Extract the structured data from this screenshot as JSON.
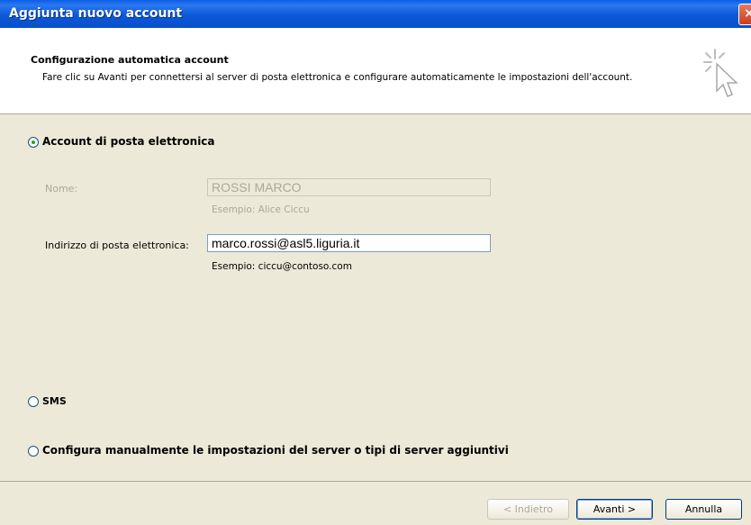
{
  "window": {
    "title": "Aggiunta nuovo account",
    "close_label": "×"
  },
  "header": {
    "title": "Configurazione automatica account",
    "description": "Fare clic su Avanti per connettersi al server di posta elettronica e configurare automaticamente le impostazioni dell'account."
  },
  "options": {
    "email_account": {
      "label": "Account di posta elettronica",
      "selected": true
    },
    "sms": {
      "label": "SMS",
      "selected": false
    },
    "manual": {
      "label": "Configura manualmente le impostazioni del server o tipi di server aggiuntivi",
      "selected": false
    }
  },
  "form": {
    "name": {
      "label": "Nome:",
      "value": "ROSSI MARCO",
      "example": "Esempio: Alice Ciccu"
    },
    "email": {
      "label": "Indirizzo di posta elettronica:",
      "value": "marco.rossi@asl5.liguria.it",
      "example": "Esempio: ciccu@contoso.com"
    }
  },
  "buttons": {
    "back": "< Indietro",
    "next": "Avanti >",
    "cancel": "Annulla"
  }
}
